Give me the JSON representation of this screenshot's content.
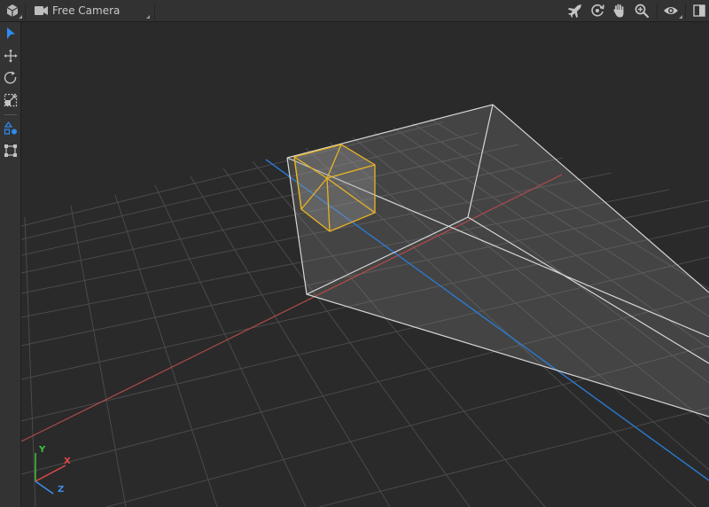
{
  "toolbar": {
    "camera_label": "Free Camera",
    "right_icons": [
      "fly-icon",
      "orbit-icon",
      "pan-hand-icon",
      "zoom-icon",
      "visibility-eye-icon",
      "panel-toggle-icon"
    ]
  },
  "tools": [
    "select-arrow-icon",
    "move-icon",
    "rotate-icon",
    "scale-icon",
    "create-shapes-icon",
    "bounding-box-icon"
  ],
  "gizmo": {
    "x": "X",
    "y": "Y",
    "z": "Z"
  },
  "colors": {
    "accent": "#2e8cf0",
    "selection": "#e8b422",
    "axis_x": "#b24a4a",
    "axis_z": "#2a7ad0",
    "gizmo_x": "#e04848",
    "gizmo_y": "#40c040",
    "gizmo_z": "#3e8ee8"
  }
}
